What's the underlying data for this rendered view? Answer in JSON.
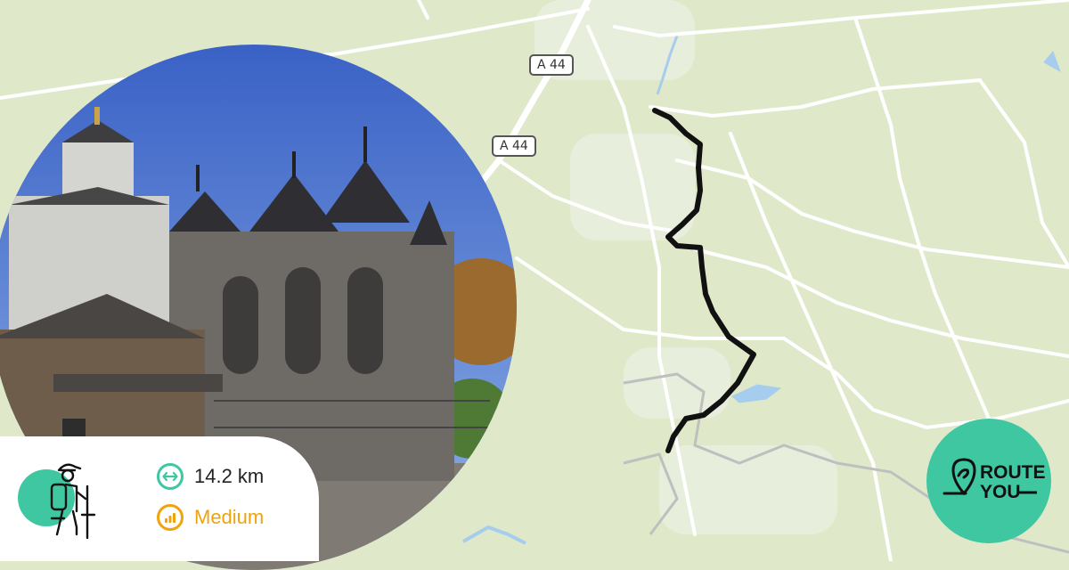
{
  "map": {
    "road_labels": [
      "A 44",
      "A 44"
    ],
    "colors": {
      "land": "#dfe9c9",
      "road": "#ffffff",
      "water": "#a6cdee",
      "track": "#111111"
    }
  },
  "photo": {
    "subject": "church-photo"
  },
  "route": {
    "distance": "14.2 km",
    "difficulty": "Medium",
    "activity_icon": "hiker-icon",
    "colors": {
      "badge": "#3ec7a1",
      "distance": "#3ec7a1",
      "difficulty": "#f0a30a"
    }
  },
  "brand": {
    "line1": "ROUTE",
    "line2": "YOU",
    "color": "#3ec7a1"
  }
}
